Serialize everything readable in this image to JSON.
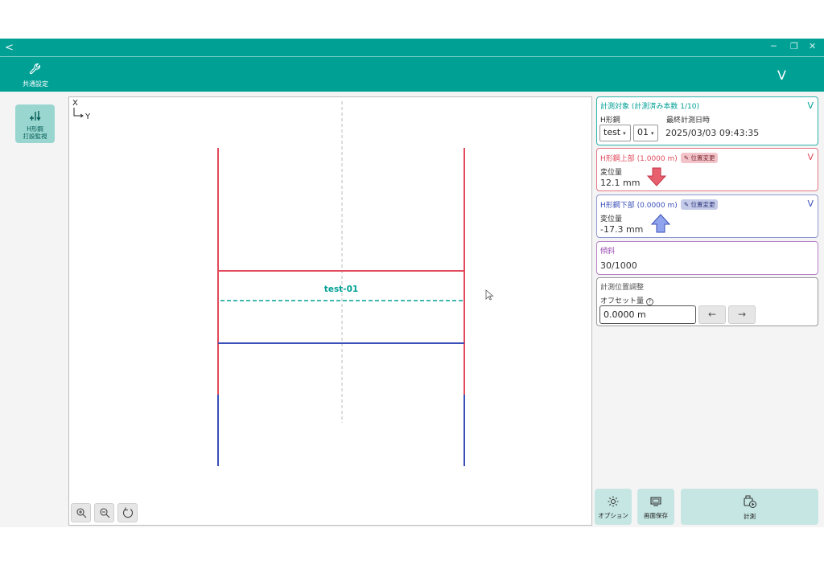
{
  "titlebar": {
    "back_glyph": "<",
    "settings_label": "共通設定",
    "expand_glyph": "V"
  },
  "sidebar": {
    "monitor_label_1": "H形鋼",
    "monitor_label_2": "打設監視"
  },
  "canvas": {
    "axis_x": "X",
    "axis_y": "Y",
    "target_label": "test-01"
  },
  "target_card": {
    "title": "計測対象 (計測済み本数 1/10)",
    "h_label": "H形鋼",
    "last_label": "最終計測日時",
    "select1": "test",
    "select2": "01",
    "last_datetime": "2025/03/03 09:43:35"
  },
  "upper_card": {
    "title": "H形鋼上部 (1.0000 m)",
    "badge": "位置変更",
    "disp_label": "変位量",
    "disp_value": "12.1 mm"
  },
  "lower_card": {
    "title": "H形鋼下部 (0.0000 m)",
    "badge": "位置変更",
    "disp_label": "変位量",
    "disp_value": "-17.3 mm"
  },
  "tilt_card": {
    "title": "傾斜",
    "value": "30/1000"
  },
  "adjust_card": {
    "title": "計測位置調整",
    "offset_label": "オフセット量",
    "offset_value": "0.0000 m",
    "left_arrow": "←",
    "right_arrow": "→"
  },
  "actions": {
    "option_label": "オプション",
    "save_label": "画面保存",
    "measure_label": "計測"
  },
  "colors": {
    "teal": "#00a095",
    "red": "#e24a5c",
    "blue": "#3a4fb8"
  }
}
